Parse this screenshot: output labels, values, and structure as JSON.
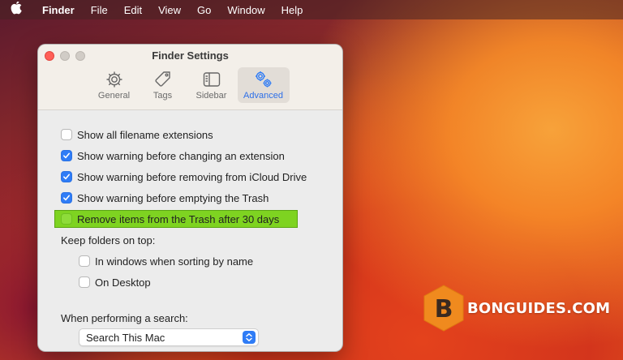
{
  "menubar": {
    "app_name": "Finder",
    "items": [
      "File",
      "Edit",
      "View",
      "Go",
      "Window",
      "Help"
    ]
  },
  "window": {
    "title": "Finder Settings",
    "tabs": [
      {
        "label": "General",
        "icon": "gear-icon",
        "active": false
      },
      {
        "label": "Tags",
        "icon": "tag-icon",
        "active": false
      },
      {
        "label": "Sidebar",
        "icon": "sidebar-icon",
        "active": false
      },
      {
        "label": "Advanced",
        "icon": "gears-icon",
        "active": true
      }
    ]
  },
  "options": [
    {
      "label": "Show all filename extensions",
      "checked": false
    },
    {
      "label": "Show warning before changing an extension",
      "checked": true
    },
    {
      "label": "Show warning before removing from iCloud Drive",
      "checked": true
    },
    {
      "label": "Show warning before emptying the Trash",
      "checked": true
    },
    {
      "label": "Remove items from the Trash after 30 days",
      "checked": false,
      "highlighted": true
    }
  ],
  "folders_on_top": {
    "heading": "Keep folders on top:",
    "items": [
      {
        "label": "In windows when sorting by name",
        "checked": false
      },
      {
        "label": "On Desktop",
        "checked": false
      }
    ]
  },
  "search": {
    "heading": "When performing a search:",
    "selected": "Search This Mac"
  },
  "watermark": {
    "letter": "B",
    "text": "BONGUIDES.COM"
  },
  "colors": {
    "accent": "#2f7cf6",
    "highlight": "#7ed321",
    "close_button": "#ff5f57",
    "watermark_hex": "#f08a1e"
  }
}
